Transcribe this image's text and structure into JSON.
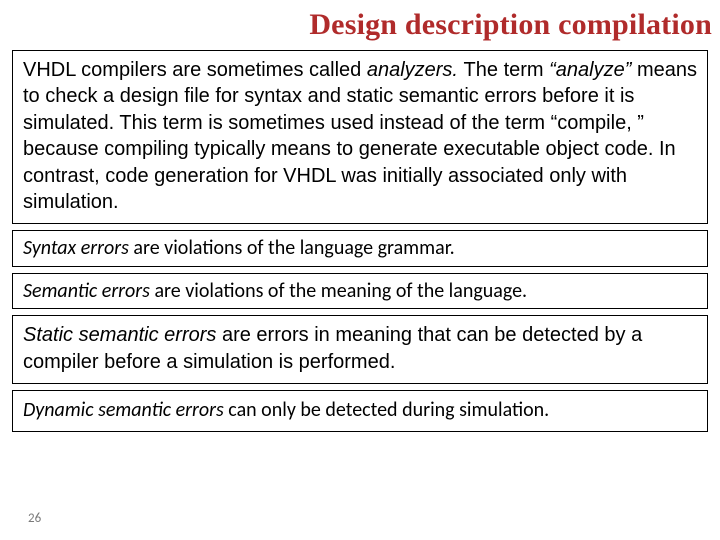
{
  "title": "Design description compilation",
  "boxes": {
    "b1": {
      "lead": "VHDL compilers are sometimes called ",
      "em1": "analyzers. ",
      "mid1": "The term ",
      "em2": "“analyze” ",
      "rest": "means to check a design file for syntax and static semantic errors before it is simulated. This term is sometimes used instead of the term “compile, ” because compiling typically means to generate executable object code. In contrast, code generation for VHDL was initially associated only with simulation."
    },
    "b2": {
      "em": "Syntax errors",
      "rest": " are violations of the language grammar."
    },
    "b3": {
      "em": "Semantic errors",
      "rest": " are violations of the meaning of the language."
    },
    "b4": {
      "em": "Static semantic errors",
      "rest": " are errors in meaning that can be detected by a compiler before a simulation is performed."
    },
    "b5": {
      "em": "Dynamic semantic errors",
      "rest": " can only be detected during simulation."
    }
  },
  "page_number": "26"
}
